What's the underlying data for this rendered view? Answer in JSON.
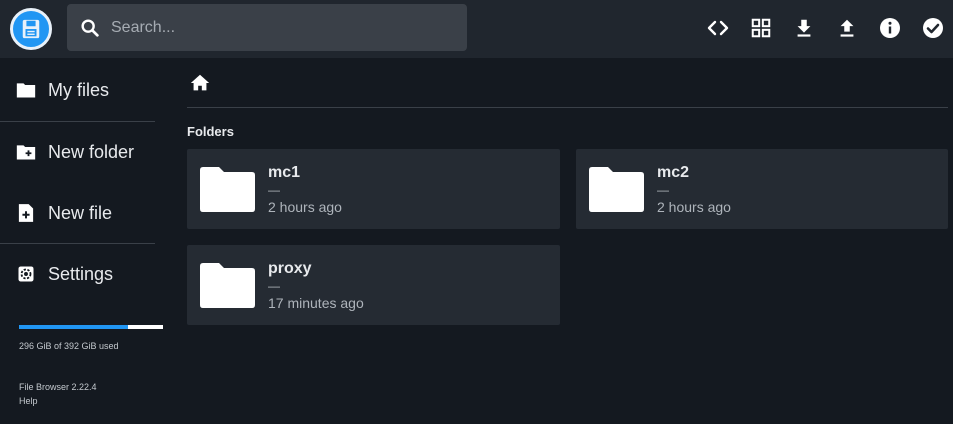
{
  "header": {
    "logo": "floppy-disk-icon",
    "search_placeholder": "Search...",
    "actions": [
      "code-icon",
      "grid-view-icon",
      "download-icon",
      "upload-icon",
      "info-icon",
      "check-circle-icon"
    ]
  },
  "sidebar": {
    "items": [
      {
        "label": "My files",
        "icon": "folder-icon"
      },
      {
        "label": "New folder",
        "icon": "create-new-folder-icon"
      },
      {
        "label": "New file",
        "icon": "note-add-icon"
      },
      {
        "label": "Settings",
        "icon": "settings-icon"
      }
    ],
    "usage_text": "296 GiB of 392 GiB used",
    "usage_fraction": 0.755,
    "version": "File Browser 2.22.4",
    "help": "Help"
  },
  "main": {
    "section_title": "Folders",
    "folders": [
      {
        "name": "mc1",
        "size": "—",
        "modified": "2 hours ago"
      },
      {
        "name": "mc2",
        "size": "—",
        "modified": "2 hours ago"
      },
      {
        "name": "proxy",
        "size": "—",
        "modified": "17 minutes ago"
      }
    ]
  },
  "colors": {
    "accent": "#2196f3",
    "background": "#141920",
    "surface": "#20262e",
    "card": "#252b33"
  }
}
